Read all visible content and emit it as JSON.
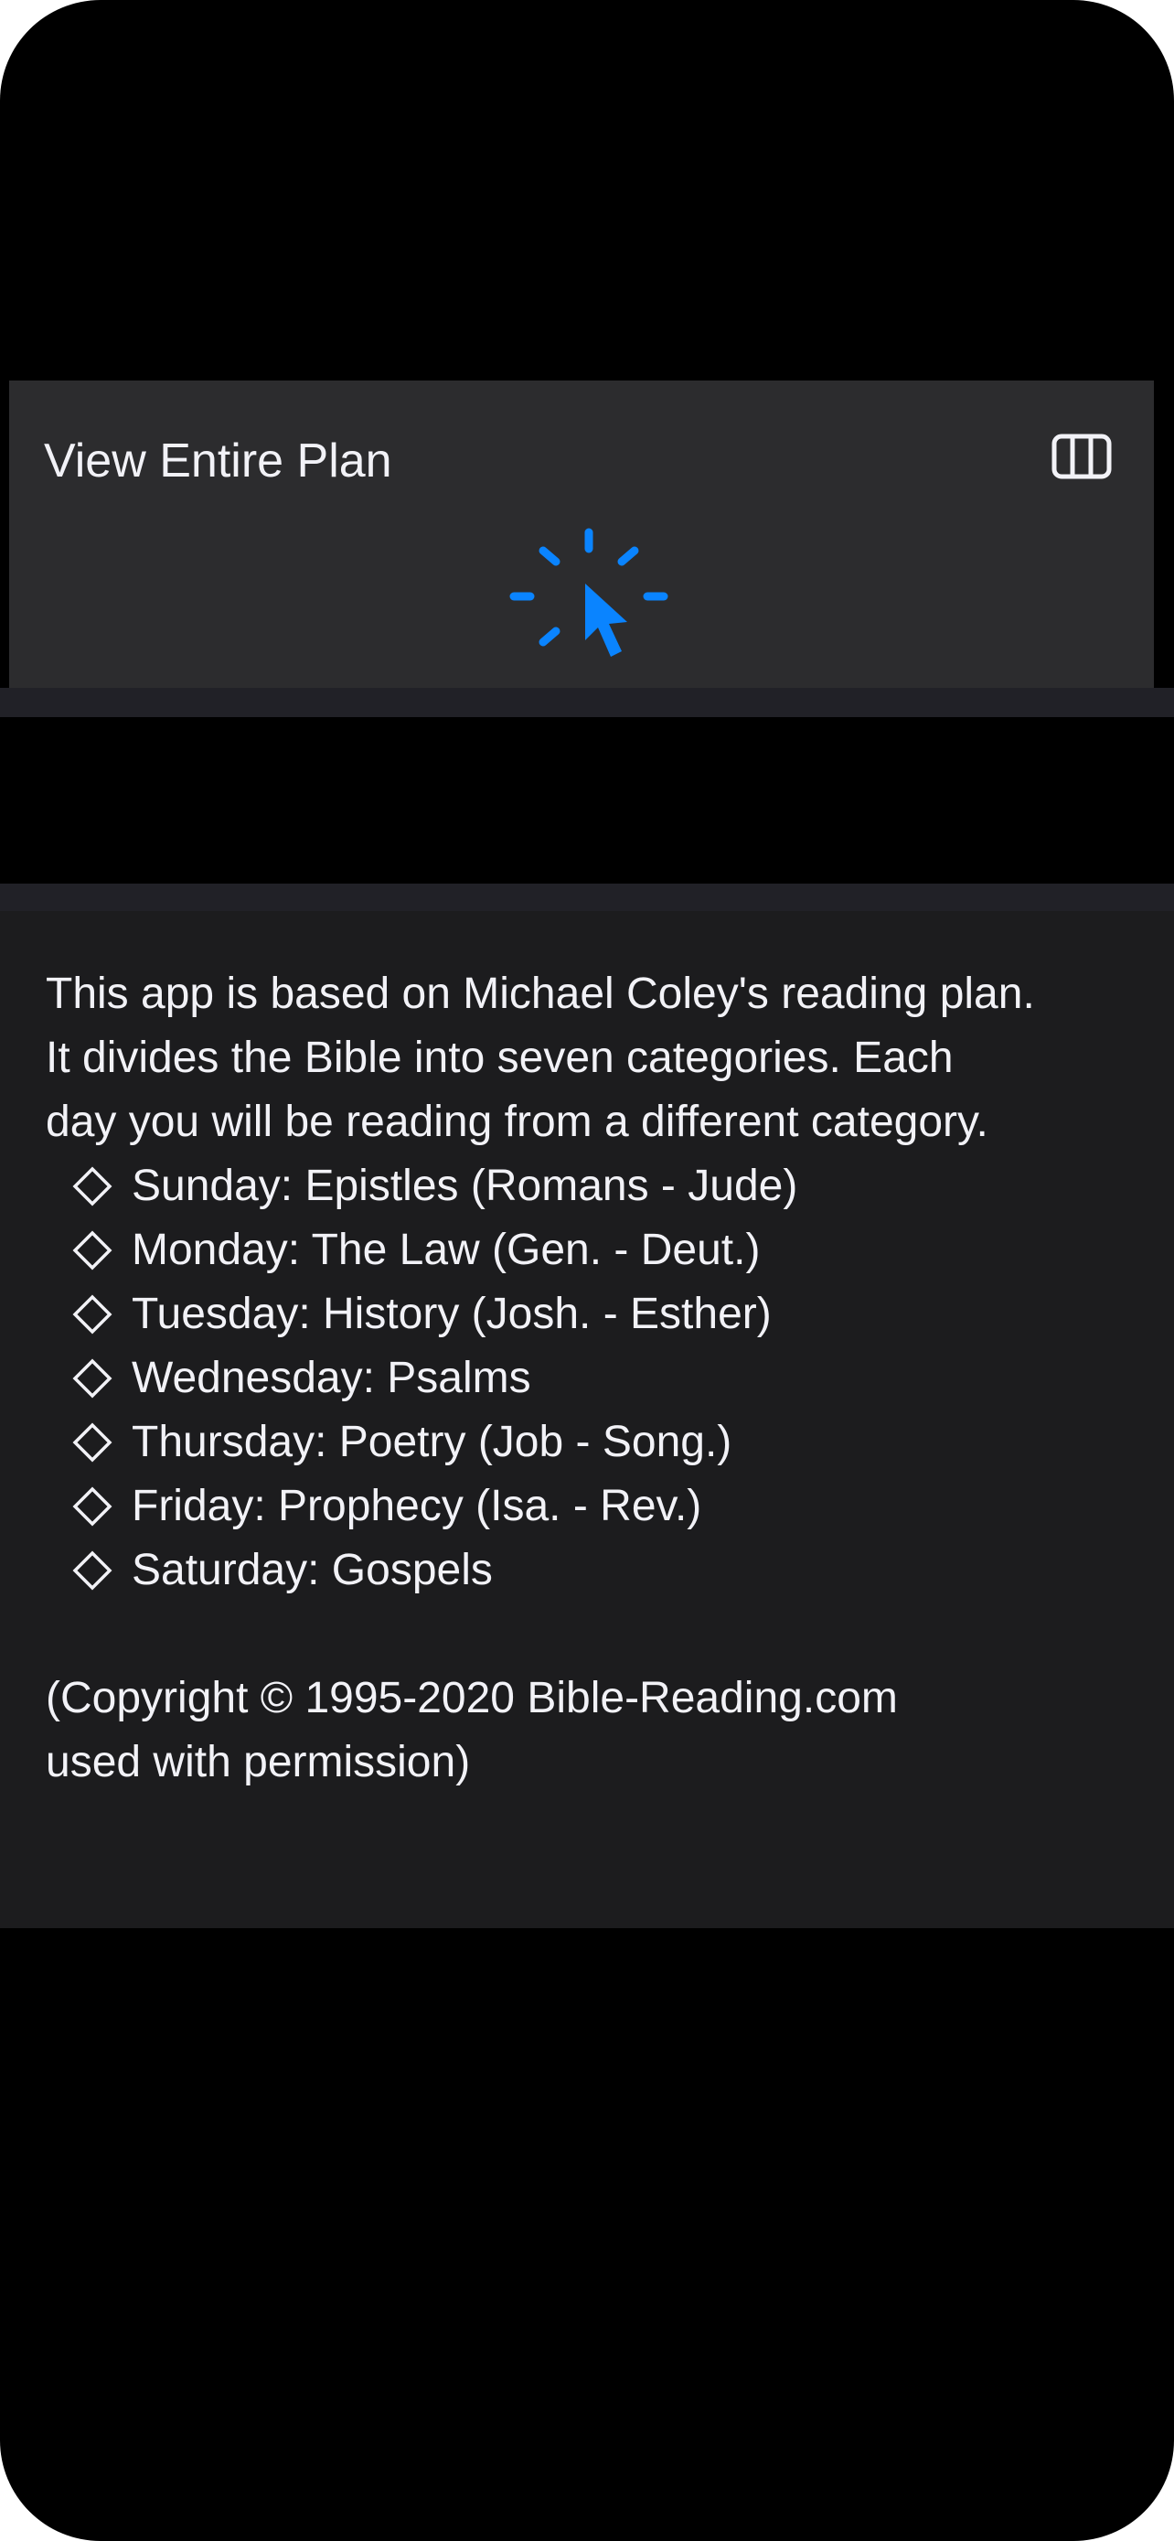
{
  "menu": {
    "title": "View Entire Plan",
    "trailing_icon": "columns-icon",
    "loading_icon": "pointer-loading-icon",
    "accent_color": "#0a84ff"
  },
  "about": {
    "intro_lines": [
      "This app is based on Michael Coley's reading plan.",
      "It divides the Bible into seven categories. Each",
      "day you will be reading from a different category."
    ],
    "bullet_icon": "diamond-icon",
    "days": [
      "Sunday: Epistles (Romans - Jude)",
      "Monday: The Law (Gen. - Deut.)",
      "Tuesday: History (Josh. - Esther)",
      "Wednesday: Psalms",
      "Thursday: Poetry (Job - Song.)",
      "Friday: Prophecy (Isa. - Rev.)",
      "Saturday: Gospels"
    ],
    "copyright_lines": [
      "(Copyright © 1995-2020 Bible-Reading.com",
      "used with permission)"
    ]
  }
}
